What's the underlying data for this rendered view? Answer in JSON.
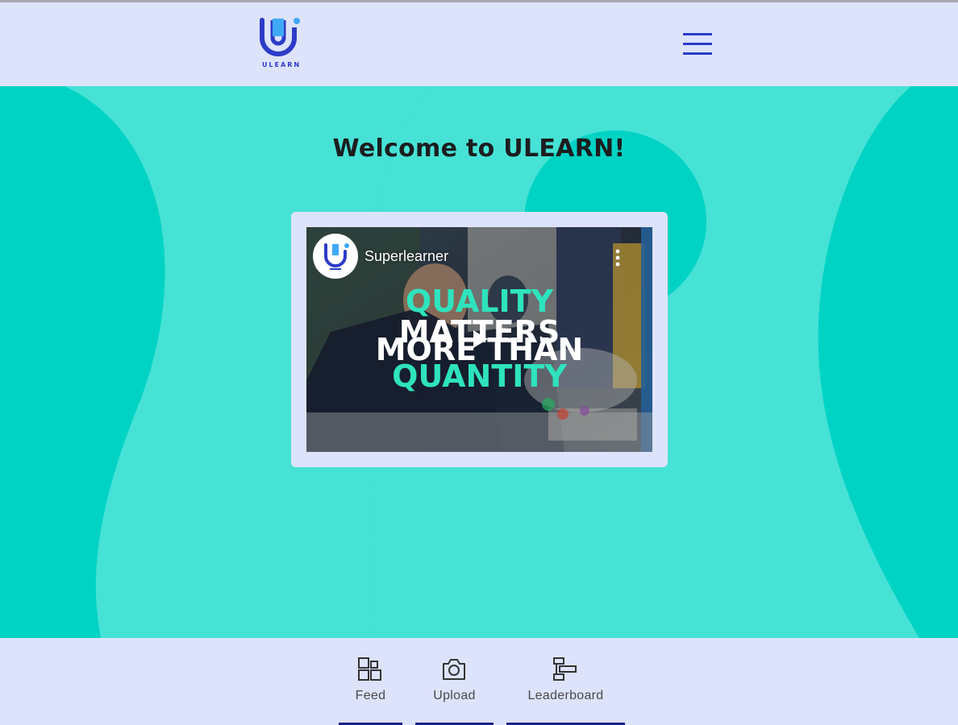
{
  "header": {
    "logo_text": "ULEARN",
    "menu_icon": "hamburger-menu-icon"
  },
  "main": {
    "welcome_title": "Welcome to ULEARN!"
  },
  "video": {
    "channel_name": "Superlearner",
    "overlay_line1": "QUALITY",
    "overlay_line2": "MATTERS",
    "overlay_line3": "MORE THAN",
    "overlay_line4": "QUANTITY",
    "play_icon": "play-icon",
    "more_icon": "kebab-menu-icon"
  },
  "bottom_nav": {
    "items": [
      {
        "label": "Feed",
        "icon": "feed-grid-icon"
      },
      {
        "label": "Upload",
        "icon": "camera-icon"
      },
      {
        "label": "Leaderboard",
        "icon": "leaderboard-icon"
      }
    ]
  },
  "colors": {
    "header_bg": "#dde3fb",
    "main_bg": "#00d3c4",
    "main_shape": "#46e2d6",
    "brand_blue": "#2d3cc8",
    "nav_underline": "#1a2390",
    "video_accent": "#2ee3bd"
  }
}
